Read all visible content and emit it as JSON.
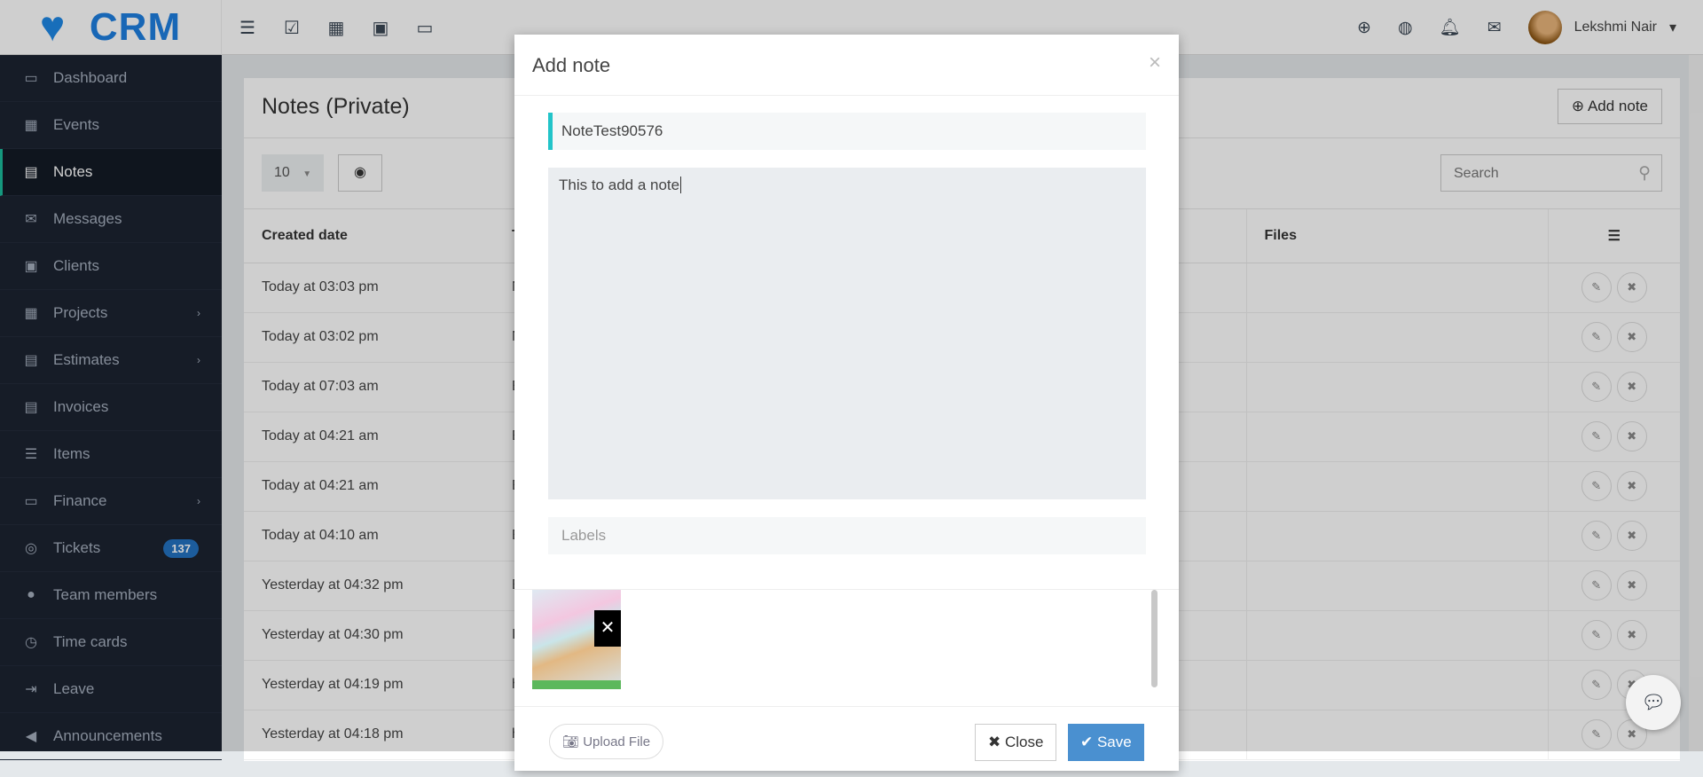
{
  "app": {
    "logo": "CRM",
    "user": "Lekshmi Nair"
  },
  "topbar": {
    "left_icons": [
      "outdent-icon",
      "checkbox-icon",
      "grid-icon",
      "briefcase-icon",
      "monitor-icon"
    ],
    "right_icons": [
      "plus-circle-icon",
      "globe-icon",
      "bell-icon",
      "envelope-icon"
    ]
  },
  "sidebar": {
    "items": [
      {
        "label": "Dashboard",
        "icon": "▭"
      },
      {
        "label": "Events",
        "icon": "▦"
      },
      {
        "label": "Notes",
        "icon": "▤",
        "active": true
      },
      {
        "label": "Messages",
        "icon": "✉"
      },
      {
        "label": "Clients",
        "icon": "▣"
      },
      {
        "label": "Projects",
        "icon": "▦",
        "chev": true
      },
      {
        "label": "Estimates",
        "icon": "▤",
        "chev": true
      },
      {
        "label": "Invoices",
        "icon": "▤"
      },
      {
        "label": "Items",
        "icon": "☰"
      },
      {
        "label": "Finance",
        "icon": "▭",
        "chev": true
      },
      {
        "label": "Tickets",
        "icon": "◎",
        "badge": "137"
      },
      {
        "label": "Team members",
        "icon": "●"
      },
      {
        "label": "Time cards",
        "icon": "◷"
      },
      {
        "label": "Leave",
        "icon": "⇥"
      },
      {
        "label": "Announcements",
        "icon": "◀"
      }
    ]
  },
  "page": {
    "title": "Notes (Private)",
    "add_note": "Add note",
    "page_size": "10",
    "search_placeholder": "Search",
    "columns": [
      "Created date",
      "T",
      "Files"
    ],
    "rows": [
      [
        "Today at 03:03 pm",
        "N"
      ],
      [
        "Today at 03:02 pm",
        "N"
      ],
      [
        "Today at 07:03 am",
        "E"
      ],
      [
        "Today at 04:21 am",
        "E"
      ],
      [
        "Today at 04:21 am",
        "E"
      ],
      [
        "Today at 04:10 am",
        "E"
      ],
      [
        "Yesterday at 04:32 pm",
        "E"
      ],
      [
        "Yesterday at 04:30 pm",
        "I"
      ],
      [
        "Yesterday at 04:19 pm",
        "h"
      ],
      [
        "Yesterday at 04:18 pm",
        "h"
      ]
    ]
  },
  "modal": {
    "title": "Add note",
    "title_value": "NoteTest90576",
    "description_value": "This to add a note",
    "labels_placeholder": "Labels",
    "upload": "Upload File",
    "close": "Close",
    "save": "Save"
  },
  "colors": {
    "accent": "#22c4c9",
    "primary": "#4a90d0",
    "sidebar": "#1c2331"
  }
}
